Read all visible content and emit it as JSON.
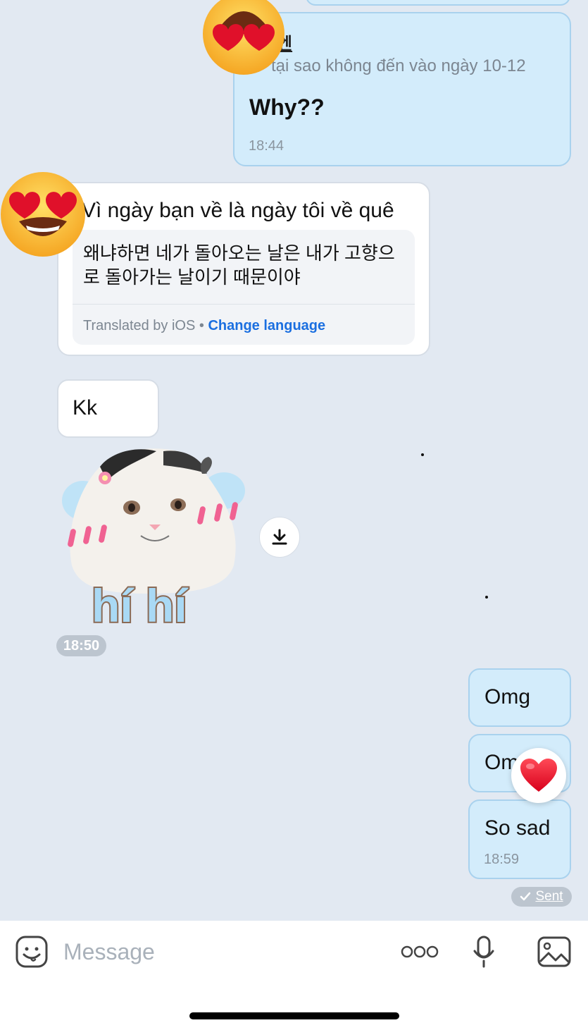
{
  "messages": {
    "reply_quote": {
      "name": "엔",
      "quoted_text": "tại sao không đến vào ngày 10-12",
      "text": "Why??",
      "time": "18:44"
    },
    "incoming_translated": {
      "text": "Vì ngày bạn về là ngày tôi về quê",
      "translation": "왜냐하면 네가 돌아오는 날은 내가 고향으로 돌아가는 날이기 때문이야",
      "translated_by": "Translated by iOS",
      "separator": " • ",
      "change_language": "Change language"
    },
    "incoming_kk": {
      "text": "Kk"
    },
    "sticker": {
      "caption": "hí hí",
      "time": "18:50"
    },
    "outgoing": [
      {
        "text": "Omg"
      },
      {
        "text": "Omg"
      },
      {
        "text": "So sad",
        "time": "18:59"
      }
    ],
    "status": {
      "label": "Sent"
    }
  },
  "composer": {
    "placeholder": "Message"
  },
  "icons": {
    "emoji_sticker": "sticker-face-icon",
    "more": "more-dots-icon",
    "mic": "microphone-icon",
    "gallery": "image-gallery-icon",
    "download": "download-icon",
    "check": "check-icon",
    "heart": "heart-icon"
  },
  "colors": {
    "background": "#e2e9f2",
    "outgoing_bubble": "#d3ecfb",
    "outgoing_border": "#a9d2ee",
    "incoming_bubble": "#ffffff",
    "link": "#1b6fe0"
  }
}
